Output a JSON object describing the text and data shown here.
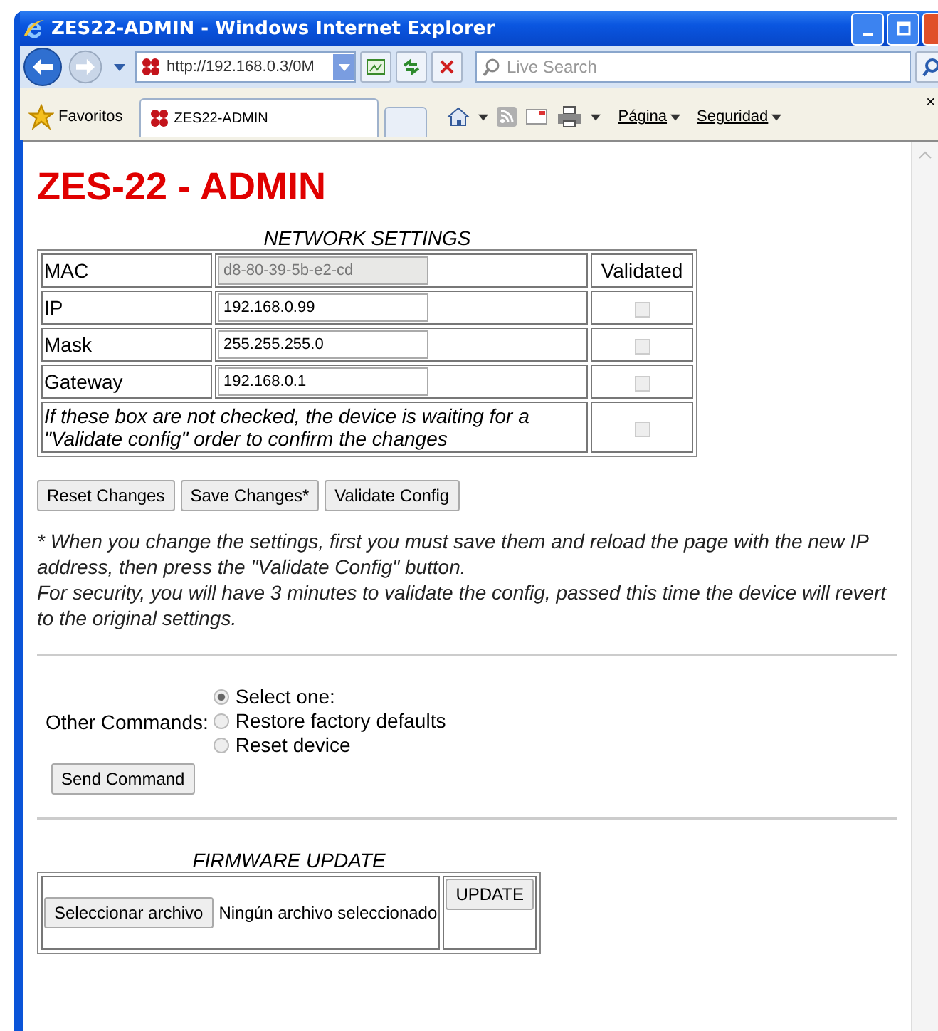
{
  "window": {
    "title": "ZES22-ADMIN - Windows Internet Explorer"
  },
  "toolbar": {
    "address": "http://192.168.0.3/0M",
    "search_placeholder": "Live Search"
  },
  "command_bar": {
    "favorites": "Favoritos",
    "tab": "ZES22-ADMIN",
    "menus": [
      "Página",
      "Seguridad"
    ],
    "close_glyph": "×"
  },
  "page": {
    "heading": "ZES-22 - ADMIN",
    "network": {
      "caption": "NETWORK SETTINGS",
      "validated_header": "Validated",
      "rows": [
        {
          "label": "MAC",
          "value": "d8-80-39-5b-e2-cd",
          "readonly": true
        },
        {
          "label": "IP",
          "value": "192.168.0.99",
          "readonly": false,
          "validated": {
            "checked": false,
            "disabled": true
          }
        },
        {
          "label": "Mask",
          "value": "255.255.255.0",
          "readonly": false,
          "validated": {
            "checked": false,
            "disabled": true
          }
        },
        {
          "label": "Gateway",
          "value": "192.168.0.1",
          "readonly": false,
          "validated": {
            "checked": false,
            "disabled": true
          }
        }
      ],
      "note": "If these box are not checked, the device is waiting for a \"Validate config\" order to confirm the changes",
      "note_check": {
        "checked": false,
        "disabled": true
      }
    },
    "buttons": [
      "Reset Changes",
      "Save Changes*",
      "Validate Config"
    ],
    "notes": [
      "* When you change the settings, first you must save them and reload the page with the new IP address, then press the \"Validate Config\" button.",
      "For security, you will have 3 minutes to validate the config, passed this time the device will revert to the original settings."
    ],
    "commands": {
      "label": "Other Commands:",
      "options": [
        {
          "label": "Select one:",
          "selected": true
        },
        {
          "label": "Restore factory defaults",
          "selected": false
        },
        {
          "label": "Reset device",
          "selected": false
        }
      ],
      "send": "Send Command"
    },
    "firmware": {
      "caption": "FIRMWARE UPDATE",
      "choose": "Seleccionar archivo",
      "status": "Ningún archivo seleccionado",
      "update": "UPDATE"
    }
  }
}
